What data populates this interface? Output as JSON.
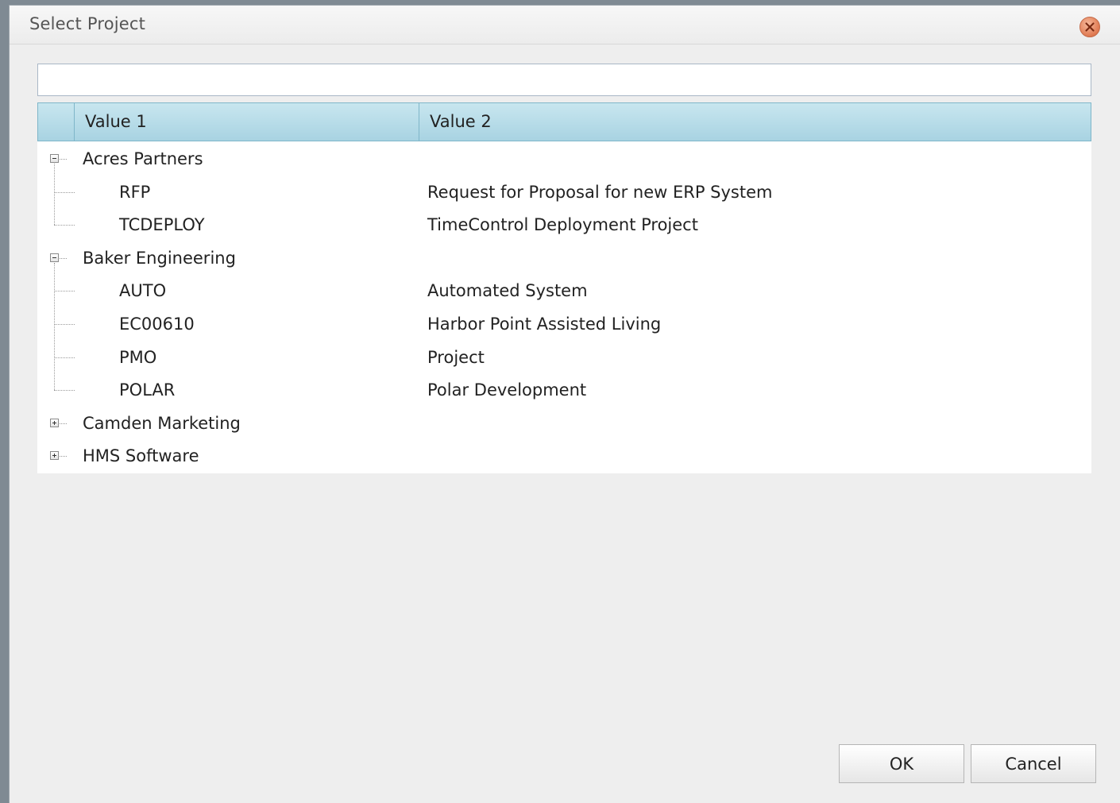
{
  "dialog": {
    "title": "Select Project",
    "close_icon": "close-icon",
    "search": {
      "value": "",
      "placeholder": ""
    }
  },
  "grid": {
    "columns": [
      "",
      "Value 1",
      "Value 2"
    ],
    "groups": [
      {
        "name": "Acres Partners",
        "expanded": true,
        "items": [
          {
            "code": "RFP",
            "description": "Request for Proposal for new ERP System"
          },
          {
            "code": "TCDEPLOY",
            "description": "TimeControl Deployment Project"
          }
        ]
      },
      {
        "name": "Baker Engineering",
        "expanded": true,
        "items": [
          {
            "code": "AUTO",
            "description": "Automated System"
          },
          {
            "code": "EC00610",
            "description": "Harbor Point Assisted Living"
          },
          {
            "code": "PMO",
            "description": "Project"
          },
          {
            "code": "POLAR",
            "description": "Polar Development"
          }
        ]
      },
      {
        "name": "Camden Marketing",
        "expanded": false,
        "items": []
      },
      {
        "name": "HMS Software",
        "expanded": false,
        "items": []
      }
    ]
  },
  "buttons": {
    "ok": "OK",
    "cancel": "Cancel"
  },
  "colors": {
    "header_bg": "#b8dde9",
    "dialog_bg": "#eeeeee",
    "close_accent": "#e07a52"
  }
}
